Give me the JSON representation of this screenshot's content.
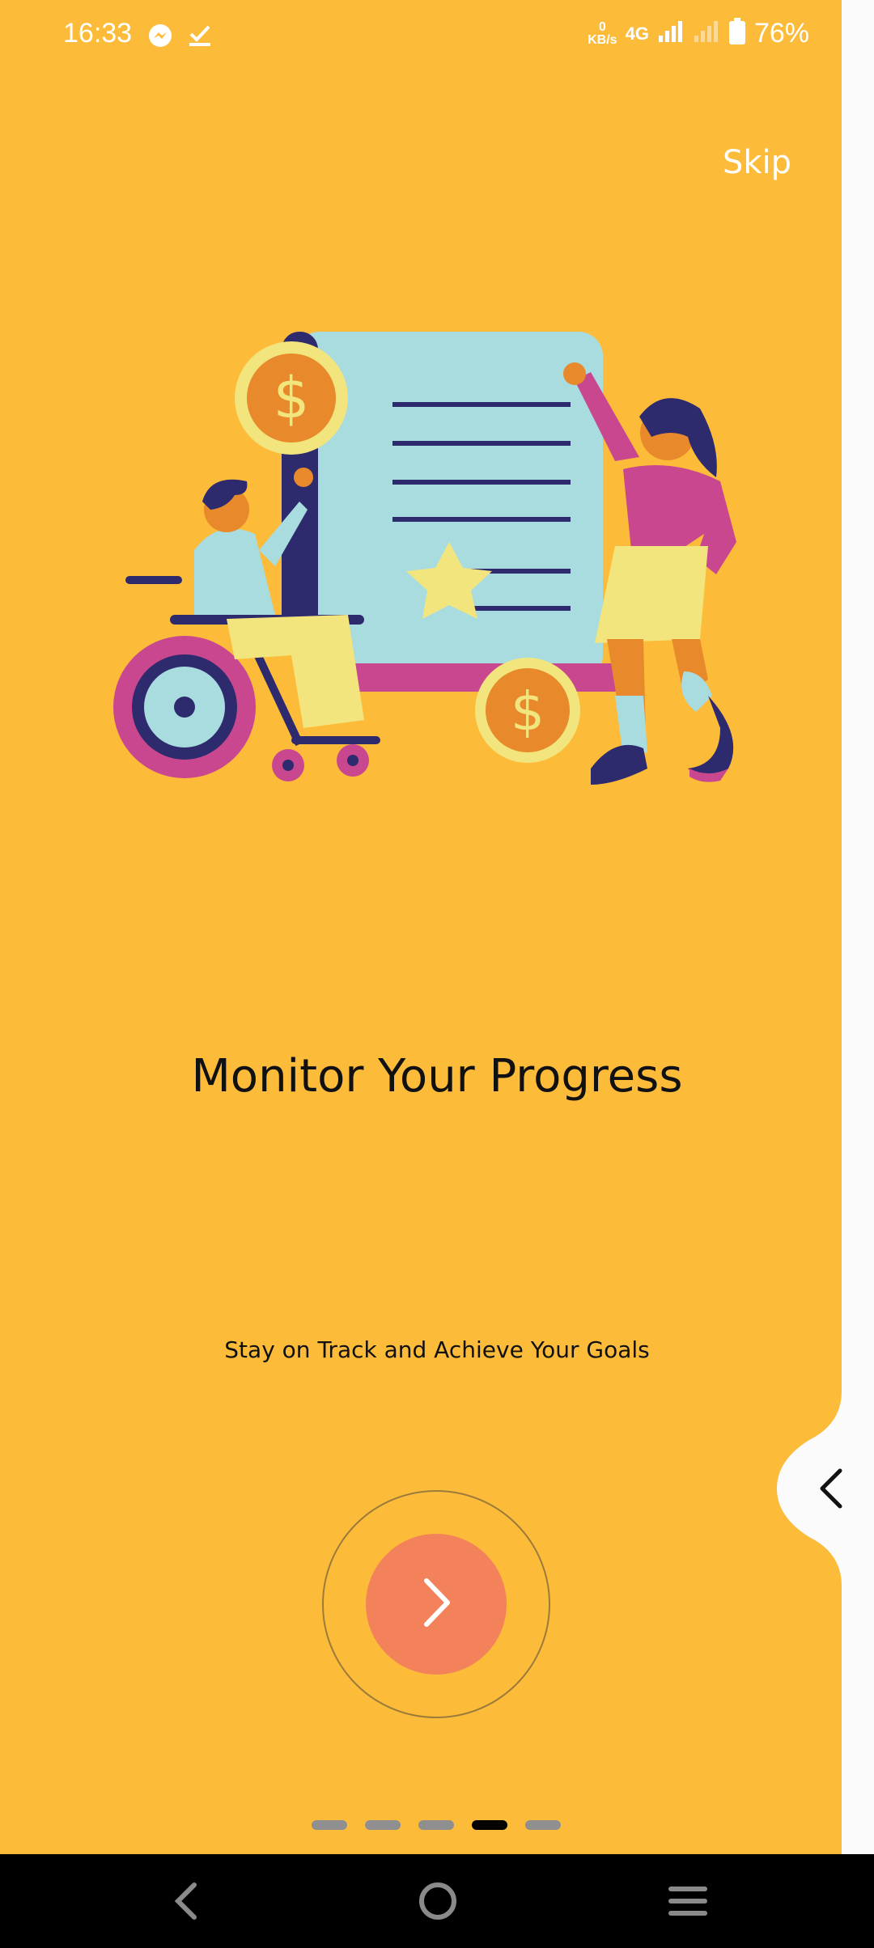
{
  "status_bar": {
    "time": "16:33",
    "net_speed_value": "0",
    "net_speed_unit": "KB/s",
    "network_type": "4G",
    "battery_percent": "76%"
  },
  "onboarding": {
    "skip_label": "Skip",
    "title": "Monitor Your Progress",
    "subtitle": "Stay on Track and Achieve Your Goals",
    "page_count": 5,
    "active_page": 4
  },
  "colors": {
    "background": "#FDBB3A",
    "next_button": "#F3825A",
    "dot_inactive": "#8f8f8f",
    "dot_active": "#000000"
  },
  "icons": {
    "messenger": "messenger-icon",
    "task_done": "checkmark-icon",
    "signal": "signal-icon",
    "battery": "battery-icon",
    "next": "chevron-right-icon",
    "edge_back": "chevron-left-icon",
    "nav_back": "back-icon",
    "nav_home": "home-icon",
    "nav_menu": "menu-icon"
  }
}
